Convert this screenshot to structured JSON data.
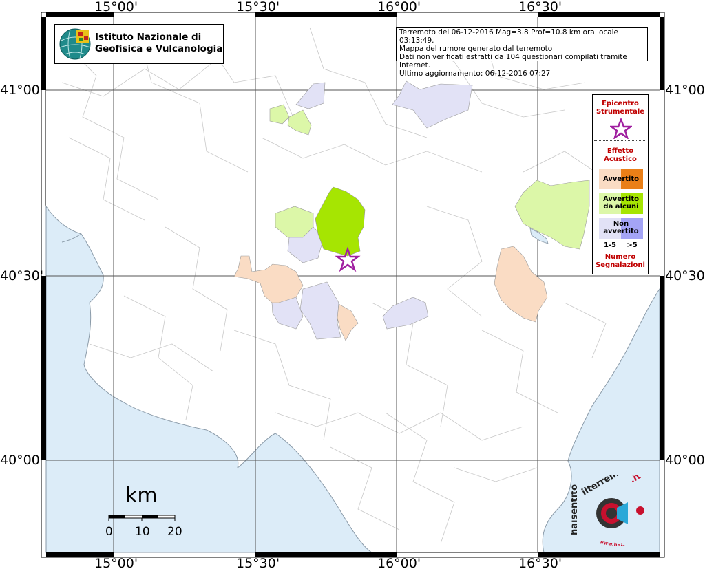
{
  "map": {
    "lon_labels": [
      "15°00'",
      "15°30'",
      "16°00'",
      "16°30'"
    ],
    "lat_labels": [
      "41°00'",
      "40°30'",
      "40°00'"
    ],
    "colors": {
      "sea": "#dcecf8",
      "land": "#ffffff",
      "avvertito_light": "#fadcc4",
      "avvertito_dark": "#ea7f17",
      "avvertito_alcuni_light": "#dcf7a8",
      "avvertito_alcuni_dark": "#a6e502",
      "non_avvertito_light": "#e2e2f6",
      "non_avvertito_dark": "#a4a4f6",
      "epicenter": "#a020a0"
    }
  },
  "logo": {
    "line1": "Istituto Nazionale di",
    "line2": "Geofisica e Vulcanologia",
    "icon": "ingv-globe-icon"
  },
  "info": {
    "line1": "Terremoto del 06-12-2016 Mag=3.8 Prof=10.8 km ora locale 03:13:49.",
    "line2": "Mappa del rumore generato dal terremoto",
    "line3": "Dati non verificati estratti da 104 questionari compilati tramite Internet.",
    "line4": "Ultimo aggiornamento: 06-12-2016 07:27"
  },
  "legend": {
    "epicentro_1": "Epicentro",
    "epicentro_2": "Strumentale",
    "effetto_1": "Effetto",
    "effetto_2": "Acustico",
    "avvertito": "Avvertito",
    "alcuni_1": "Avvertito",
    "alcuni_2": "da alcuni",
    "non_1": "Non",
    "non_2": "avvertito",
    "range_low": "1-5",
    "range_high": ">5",
    "numero_1": "Numero",
    "numero_2": "Segnalazioni"
  },
  "scalebar": {
    "unit": "km",
    "ticks": [
      "0",
      "10",
      "20"
    ]
  },
  "hai_logo": {
    "top": "haisentito",
    "mid": "ilterremoto",
    "suffix": ".it",
    "bottom": "www.haisentitoilterremoto.it"
  }
}
